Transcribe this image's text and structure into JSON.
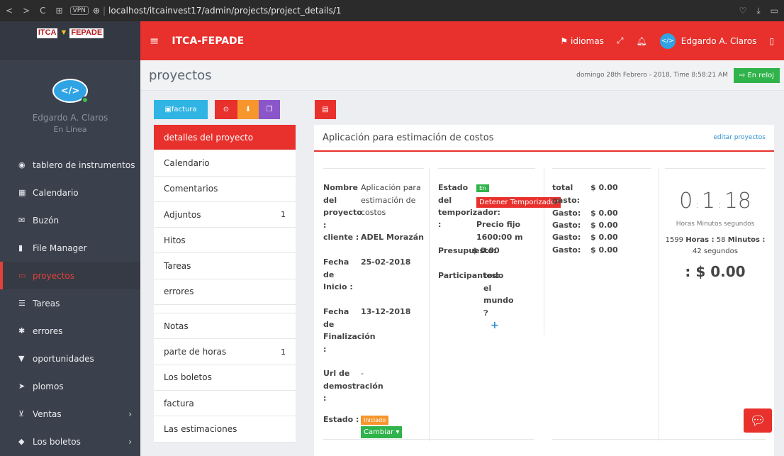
{
  "browser": {
    "url": "localhost/itcainvest17/admin/projects/project_details/1",
    "vpn": "VPN"
  },
  "brand": {
    "logo_a": "ITCA",
    "logo_b": "▼",
    "logo_c": "FEPADE"
  },
  "user_panel": {
    "name": "Edgardo A. Claros",
    "status": "En Línea"
  },
  "sidebar": {
    "items": [
      {
        "label": "tablero de instrumentos",
        "icon": "dashboard-icon"
      },
      {
        "label": "Calendario",
        "icon": "calendar-icon"
      },
      {
        "label": "Buzón",
        "icon": "mail-icon"
      },
      {
        "label": "File Manager",
        "icon": "file-icon"
      },
      {
        "label": "proyectos",
        "icon": "folder-icon"
      },
      {
        "label": "Tareas",
        "icon": "tasks-icon"
      },
      {
        "label": "errores",
        "icon": "bug-icon"
      },
      {
        "label": "oportunidades",
        "icon": "filter-icon"
      },
      {
        "label": "plomos",
        "icon": "rocket-icon"
      },
      {
        "label": "Ventas",
        "icon": "cart-icon"
      },
      {
        "label": "Los boletos",
        "icon": "ticket-icon"
      }
    ]
  },
  "header": {
    "title": "ITCA-FEPADE",
    "languages": "idiomas",
    "user": "Edgardo A. Claros"
  },
  "page": {
    "title": "proyectos",
    "date": "domingo 28th Febrero - 2018, Time  8:58:21 AM",
    "clock_in": "En reloj"
  },
  "toolbar": {
    "factura": "factura"
  },
  "tabs": [
    {
      "label": "detalles del proyecto",
      "count": ""
    },
    {
      "label": "Calendario",
      "count": ""
    },
    {
      "label": "Comentarios",
      "count": ""
    },
    {
      "label": "Adjuntos",
      "count": "1"
    },
    {
      "label": "Hitos",
      "count": ""
    },
    {
      "label": "Tareas",
      "count": ""
    },
    {
      "label": "errores",
      "count": ""
    },
    {
      "label": "Notas",
      "count": ""
    },
    {
      "label": "parte de horas",
      "count": "1"
    },
    {
      "label": "Los boletos",
      "count": ""
    },
    {
      "label": "factura",
      "count": ""
    },
    {
      "label": "Las estimaciones",
      "count": ""
    }
  ],
  "card": {
    "title": "Aplicación para estimación de costos",
    "edit": "editar proyectos",
    "col1": {
      "name_label": "Nombre del proyecto :",
      "name_value": "Aplicación para estimación de costos",
      "client_label": "cliente :",
      "client_value": "ADEL Morazán",
      "start_label": "Fecha de Inicio :",
      "start_value": "25-02-2018",
      "end_label": "Fecha de Finalización :",
      "end_value": "13-12-2018",
      "demo_label": "Url de demostración :",
      "demo_value": "-",
      "state_label": "Estado :",
      "state_value": "Iniciado",
      "change": "Cambiar"
    },
    "col2": {
      "timer_label": "Estado del temporizador:",
      "timer_on": "En",
      "timer_stop": "Detener Temporizador",
      "price_label": ":",
      "price_value": "Precio fijo 1600:00 m",
      "budget_label": "Presupuesto:",
      "budget_value": "$ 0.00",
      "participants_label": "Participantes:",
      "participants_value": "todo el mundo"
    },
    "col3": {
      "rows": [
        {
          "label": "total gasto:",
          "value": "$ 0.00"
        },
        {
          "label": "Gasto:",
          "value": "$ 0.00"
        },
        {
          "label": "Gasto:",
          "value": "$ 0.00"
        },
        {
          "label": "Gasto:",
          "value": "$ 0.00"
        },
        {
          "label": "Gasto:",
          "value": "$ 0.00"
        }
      ]
    },
    "col4": {
      "h": "0",
      "m": "1",
      "s": "18",
      "units": "Horas Minutos segundos",
      "total_hours": "1599",
      "total_minutes": "58",
      "total_seconds": "42",
      "hours_word": "Horas :",
      "minutes_word": "Minutos :",
      "seconds_word": "segundos",
      "amount": ": $ 0.00"
    }
  }
}
